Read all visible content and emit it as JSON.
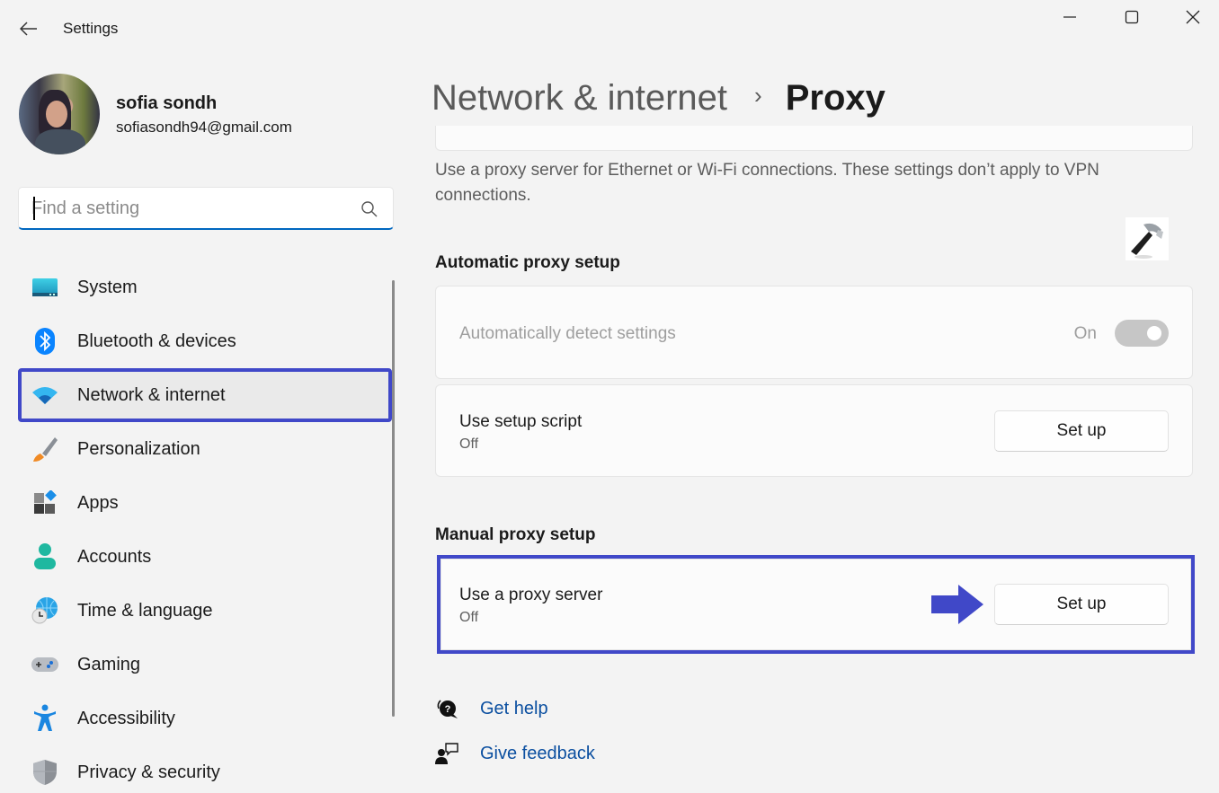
{
  "window": {
    "app_title": "Settings",
    "controls": {
      "minimize": "minimize-icon",
      "maximize": "maximize-icon",
      "close": "close-icon"
    }
  },
  "profile": {
    "name": "sofia sondh",
    "email": "sofiasondh94@gmail.com"
  },
  "search": {
    "placeholder": "Find a setting",
    "value": ""
  },
  "sidebar": {
    "selected": "Network & internet",
    "items": [
      {
        "label": "System",
        "icon": "system-icon"
      },
      {
        "label": "Bluetooth & devices",
        "icon": "bluetooth-icon"
      },
      {
        "label": "Network & internet",
        "icon": "wifi-icon"
      },
      {
        "label": "Personalization",
        "icon": "paintbrush-icon"
      },
      {
        "label": "Apps",
        "icon": "apps-icon"
      },
      {
        "label": "Accounts",
        "icon": "accounts-icon"
      },
      {
        "label": "Time & language",
        "icon": "time-language-icon"
      },
      {
        "label": "Gaming",
        "icon": "gamepad-icon"
      },
      {
        "label": "Accessibility",
        "icon": "accessibility-icon"
      },
      {
        "label": "Privacy & security",
        "icon": "shield-icon"
      }
    ]
  },
  "main": {
    "breadcrumb": {
      "parent": "Network & internet",
      "separator": "›",
      "current": "Proxy"
    },
    "description": "Use a proxy server for Ethernet or Wi-Fi connections. These settings don’t apply to VPN connections.",
    "automatic": {
      "title": "Automatic proxy setup",
      "detect": {
        "label": "Automatically detect settings",
        "state": "On",
        "enabled": true,
        "disabled_look": true
      },
      "script": {
        "label": "Use setup script",
        "status": "Off",
        "button": "Set up"
      }
    },
    "manual": {
      "title": "Manual proxy setup",
      "proxy_server": {
        "label": "Use a proxy server",
        "status": "Off",
        "button": "Set up"
      }
    },
    "links": [
      {
        "label": "Get help",
        "icon": "get-help-icon"
      },
      {
        "label": "Give feedback",
        "icon": "give-feedback-icon"
      }
    ]
  },
  "annotations": {
    "highlight_color": "#4048c8",
    "arrow_color": "#4048c8"
  }
}
